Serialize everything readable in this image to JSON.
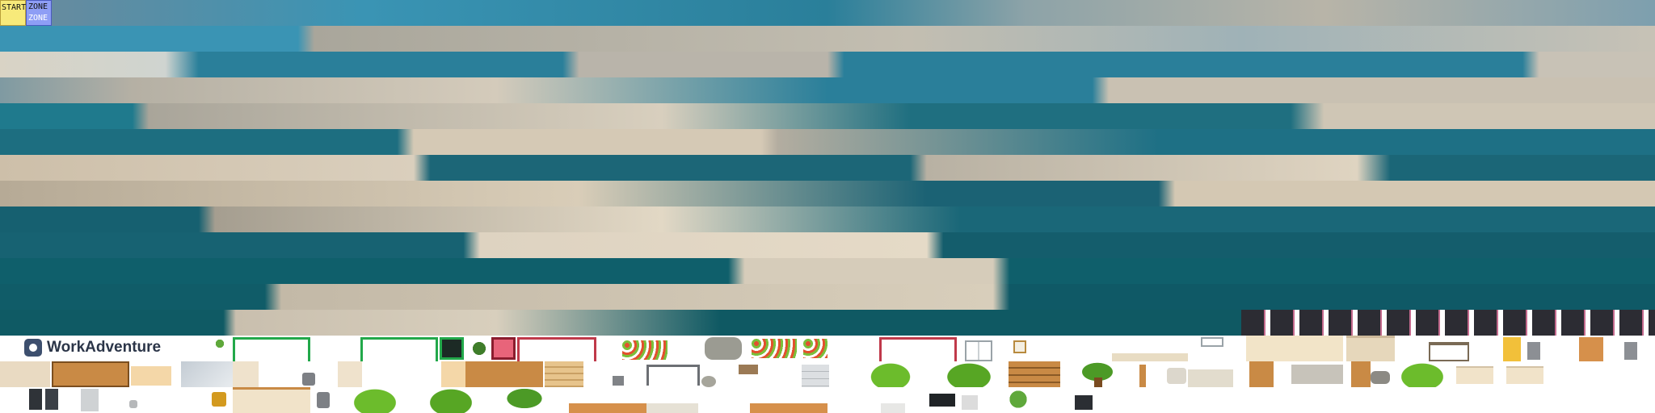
{
  "markers": {
    "start_label": "START",
    "zone_label_top": "ZONE",
    "zone_label_bottom": "ZONE"
  },
  "brand": {
    "name": "WorkAdventure"
  },
  "palette": {
    "sea_deep": "#0f5f6b",
    "sea_mid": "#2a7f9a",
    "sea_light": "#3a94b4",
    "beach": "#e6d7bf",
    "city": "#b8b4a8",
    "start_yellow": "#f7ea7a",
    "zone_blue": "#8e9ef5",
    "green_frame": "#22a84a",
    "red_frame": "#c0394a",
    "bush": "#6cbc2c",
    "wood": "#c98a45"
  },
  "icons": [
    "start-marker-icon",
    "zone-marker-icon",
    "workadventure-logo-icon",
    "plant-icon",
    "bush-icon",
    "tree-icon",
    "bench-icon",
    "chair-icon",
    "table-icon",
    "cabinet-icon",
    "monitor-icon",
    "clock-icon",
    "rock-icon",
    "flower-bed-icon"
  ]
}
